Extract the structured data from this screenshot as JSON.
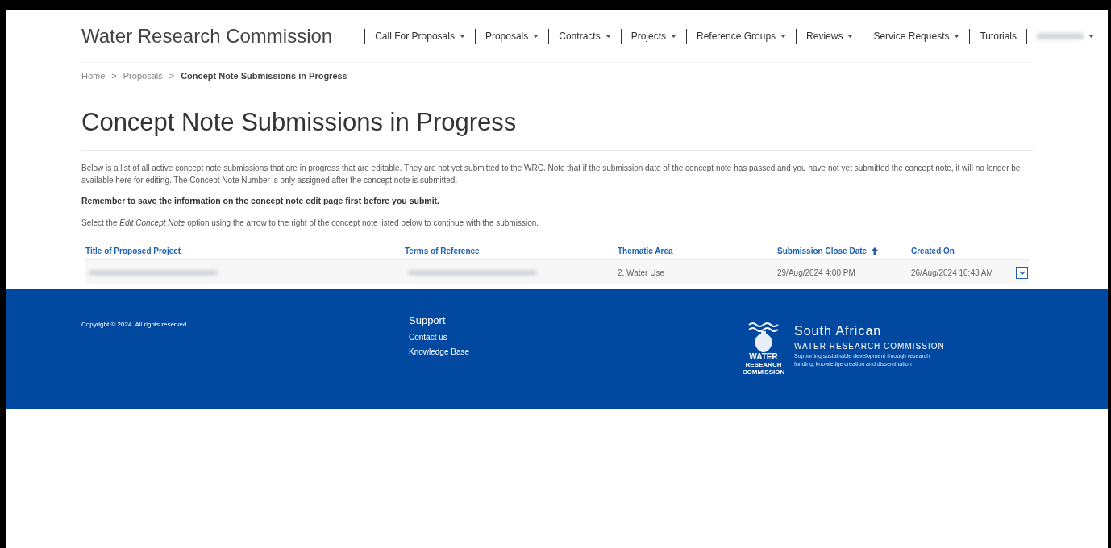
{
  "header": {
    "brand": "Water Research Commission",
    "nav": [
      {
        "label": "Call For Proposals",
        "dropdown": true
      },
      {
        "label": "Proposals",
        "dropdown": true
      },
      {
        "label": "Contracts",
        "dropdown": true
      },
      {
        "label": "Projects",
        "dropdown": true
      },
      {
        "label": "Reference Groups",
        "dropdown": true
      },
      {
        "label": "Reviews",
        "dropdown": true
      },
      {
        "label": "Service Requests",
        "dropdown": true
      },
      {
        "label": "Tutorials",
        "dropdown": false
      }
    ],
    "user_menu": {
      "blurred": true,
      "dropdown": true
    }
  },
  "breadcrumb": [
    {
      "label": "Home",
      "current": false
    },
    {
      "separator": ">",
      "label": "Proposals",
      "current": false
    },
    {
      "separator": ">",
      "label": "Concept Note Submissions in Progress",
      "current": true
    }
  ],
  "page_title": "Concept Note Submissions in Progress",
  "intro": "Below is a list of all active concept note submissions that are in progress that are editable. They are not yet submitted to the WRC. Note that if the submission date of the concept note has passed and you have not yet submitted the concept note, it will no longer be available here for editing. The Concept Note Number is only assigned after the concept note is submitted.",
  "reminder": "Remember to save the information on the concept note edit page first before you submit.",
  "instruction": "Select the *Edit Concept Note* option using the arrow to the right of the concept note listed below to continue with the submission.",
  "table": {
    "columns": [
      {
        "label": "Title of Proposed Project",
        "sorted": false
      },
      {
        "label": "Terms of Reference",
        "sorted": false
      },
      {
        "label": "Thematic Area",
        "sorted": false
      },
      {
        "label": "Submission Close Date",
        "sorted": true
      },
      {
        "label": "Created On",
        "sorted": false
      }
    ],
    "rows": [
      {
        "cells": [
          {
            "blurred": true
          },
          {
            "blurred": true
          },
          {
            "text": "2. Water Use"
          },
          {
            "text": "29/Aug/2024 4:00 PM"
          },
          {
            "text": "26/Aug/2024 10:43 AM"
          }
        ]
      }
    ]
  },
  "footer": {
    "copyright": "Copyright © 2024. All rights reserved.",
    "support_title": "Support",
    "links": [
      "Contact us",
      "Knowledge Base"
    ],
    "logo": {
      "mark_lines": [
        "WATER",
        "RESEARCH",
        "COMMISSION"
      ],
      "title": "South African",
      "subtitle": "WATER RESEARCH COMMISSION",
      "tagline": [
        "Supporting sustainable development through research",
        "funding, knowledge creation and dissemination"
      ]
    }
  }
}
